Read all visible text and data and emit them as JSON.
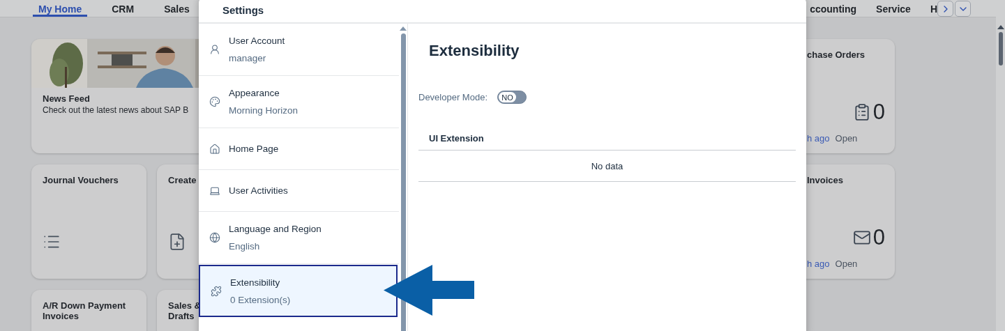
{
  "shell_tabs": {
    "left": [
      {
        "label": "My Home",
        "selected": true
      },
      {
        "label": "CRM",
        "selected": false
      },
      {
        "label": "Sales",
        "selected": false
      }
    ],
    "right": [
      {
        "label": "ccounting",
        "selected": false
      },
      {
        "label": "Service",
        "selected": false
      },
      {
        "label": "H",
        "selected": false
      }
    ]
  },
  "tiles_left": [
    [
      {
        "kind": "news",
        "title": "News Feed",
        "text": "Check out the latest news about SAP B"
      }
    ],
    [
      {
        "kind": "app",
        "title": "Journal Vouchers"
      },
      {
        "kind": "app",
        "title": "Create"
      }
    ],
    [
      {
        "kind": "app",
        "title": "A/R Down Payment Invoices"
      },
      {
        "kind": "app",
        "title": "Sales &\nDrafts"
      }
    ]
  ],
  "tiles_right": [
    {
      "title": "chase Orders",
      "count": "0",
      "age": "h ago",
      "status": "Open"
    },
    {
      "title": "Invoices",
      "count": "0",
      "age": "h ago",
      "status": "Open"
    }
  ],
  "dialog": {
    "title": "Settings",
    "items": [
      {
        "label": "User Account",
        "sub": "manager",
        "selected": false
      },
      {
        "label": "Appearance",
        "sub": "Morning Horizon",
        "selected": false
      },
      {
        "label": "Home Page",
        "selected": false
      },
      {
        "label": "User Activities",
        "selected": false
      },
      {
        "label": "Language and Region",
        "sub": "English",
        "selected": false
      },
      {
        "label": "Extensibility",
        "sub": "0 Extension(s)",
        "selected": true
      }
    ],
    "detail": {
      "title": "Extensibility",
      "developer_mode": {
        "label": "Developer Mode:",
        "on": false,
        "state_text": "NO"
      },
      "table": {
        "columns": [
          "UI Extension"
        ],
        "empty_text": "No data"
      }
    }
  }
}
